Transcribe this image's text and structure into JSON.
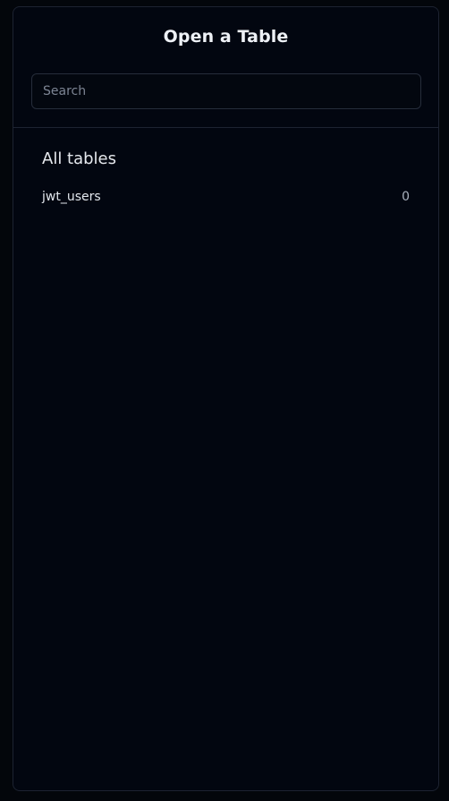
{
  "dialog": {
    "title": "Open a Table"
  },
  "search": {
    "placeholder": "Search",
    "value": ""
  },
  "tables_section": {
    "heading": "All tables",
    "items": [
      {
        "name": "jwt_users",
        "count": "0"
      }
    ]
  }
}
